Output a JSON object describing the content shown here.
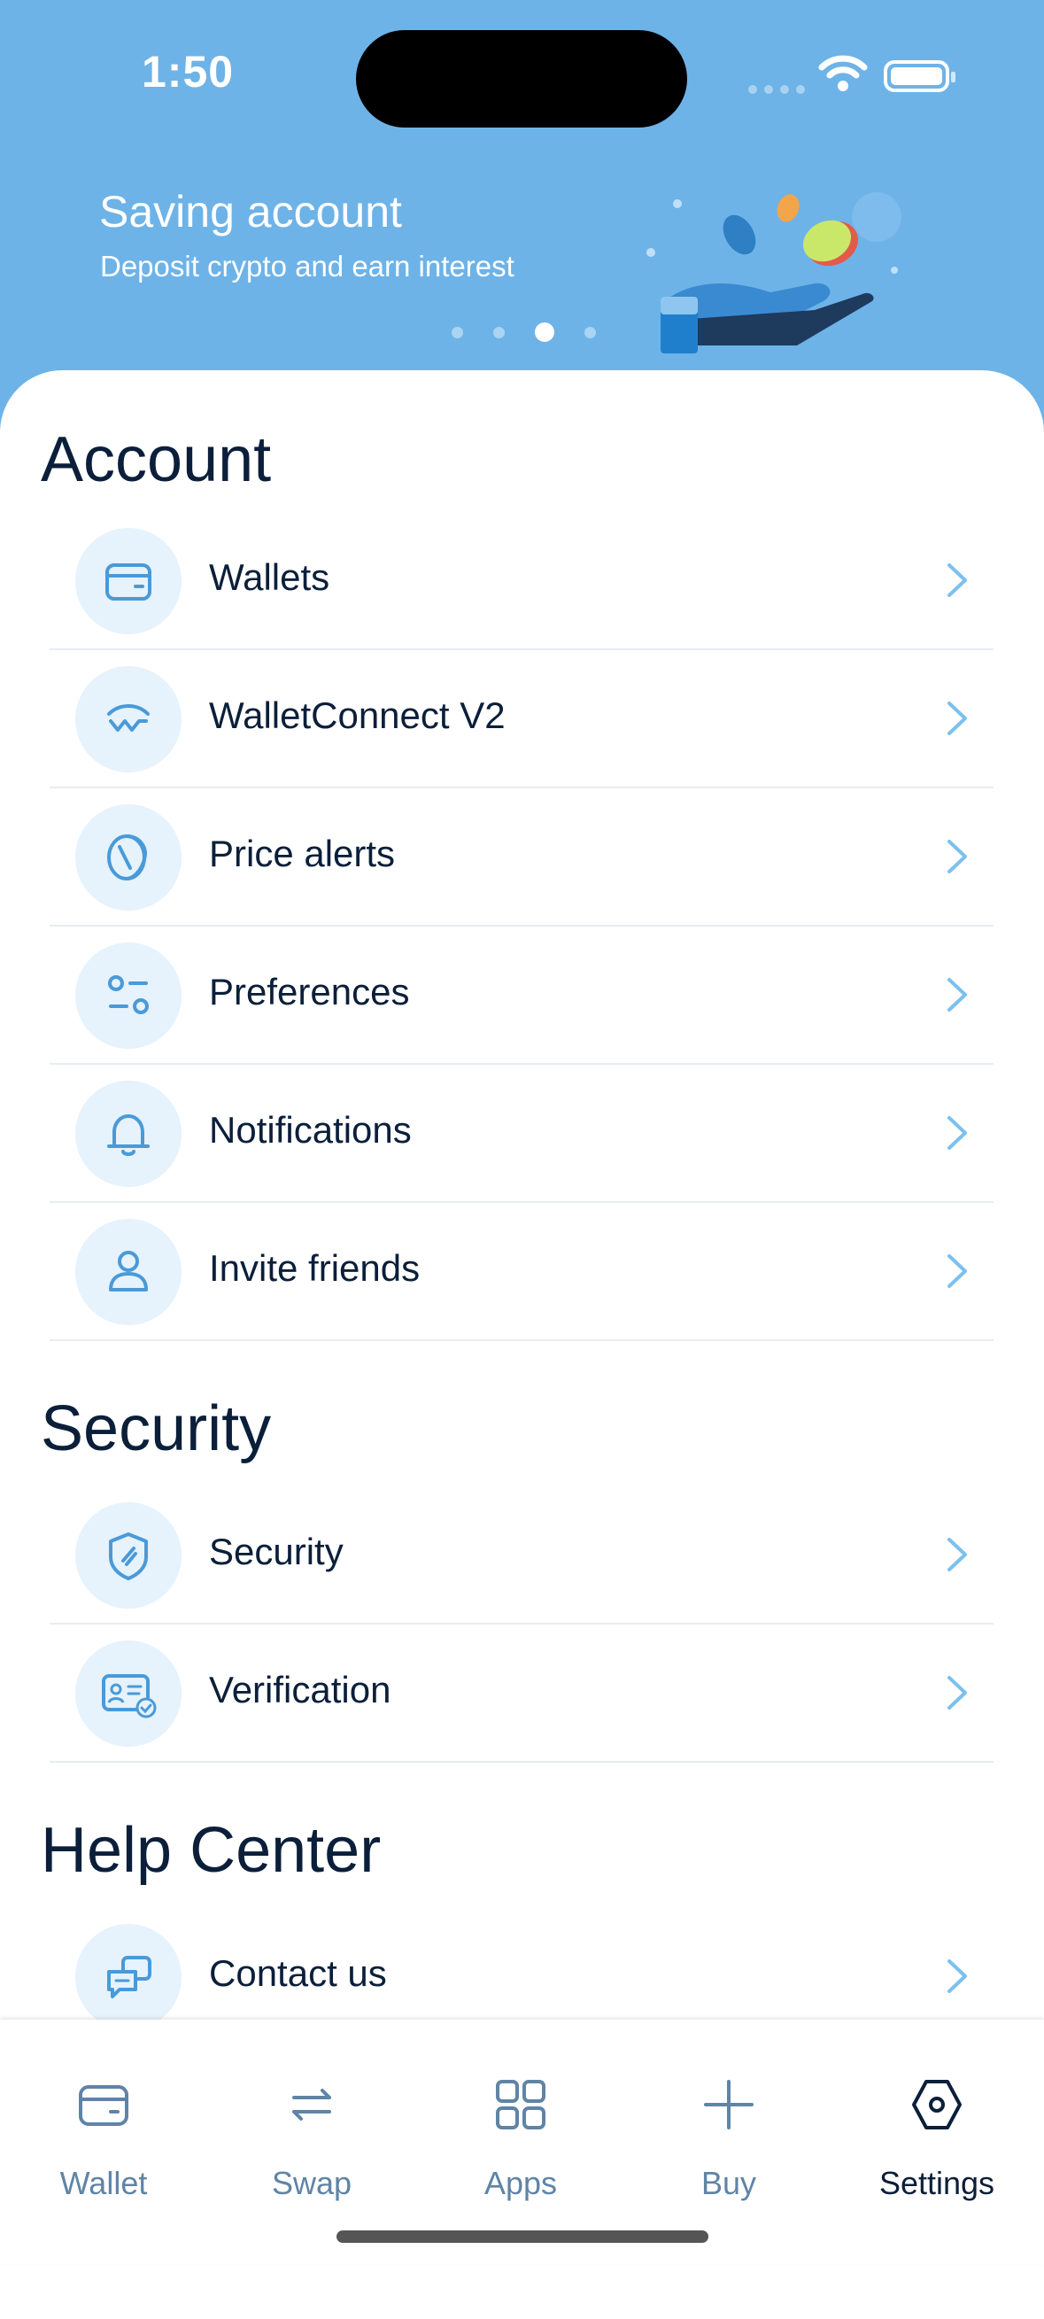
{
  "status_bar": {
    "time": "1:50"
  },
  "banner": {
    "title": "Saving account",
    "subtitle": "Deposit crypto and earn interest",
    "pages": 4,
    "active_page": 3
  },
  "sections": {
    "account": {
      "title": "Account",
      "items": [
        {
          "label": "Wallets",
          "icon": "wallet-icon"
        },
        {
          "label": "WalletConnect V2",
          "icon": "walletconnect-icon"
        },
        {
          "label": "Price alerts",
          "icon": "coin-icon"
        },
        {
          "label": "Preferences",
          "icon": "sliders-icon"
        },
        {
          "label": "Notifications",
          "icon": "bell-icon"
        },
        {
          "label": "Invite friends",
          "icon": "user-icon"
        }
      ]
    },
    "security": {
      "title": "Security",
      "items": [
        {
          "label": "Security",
          "icon": "shield-icon"
        },
        {
          "label": "Verification",
          "icon": "id-card-icon"
        }
      ]
    },
    "help": {
      "title": "Help Center",
      "items": [
        {
          "label": "Contact us",
          "icon": "chat-icon"
        }
      ]
    }
  },
  "tabbar": {
    "tabs": [
      {
        "label": "Wallet",
        "icon": "wallet-icon"
      },
      {
        "label": "Swap",
        "icon": "swap-icon"
      },
      {
        "label": "Apps",
        "icon": "grid-icon"
      },
      {
        "label": "Buy",
        "icon": "plus-icon"
      },
      {
        "label": "Settings",
        "icon": "hexagon-settings-icon",
        "active": true
      }
    ]
  },
  "colors": {
    "header_bg": "#6db3e8",
    "accent": "#4a9ad8",
    "text_dark": "#0b1f3a",
    "icon_bg": "#e6f2fc",
    "chevron": "#7cc0ee"
  }
}
